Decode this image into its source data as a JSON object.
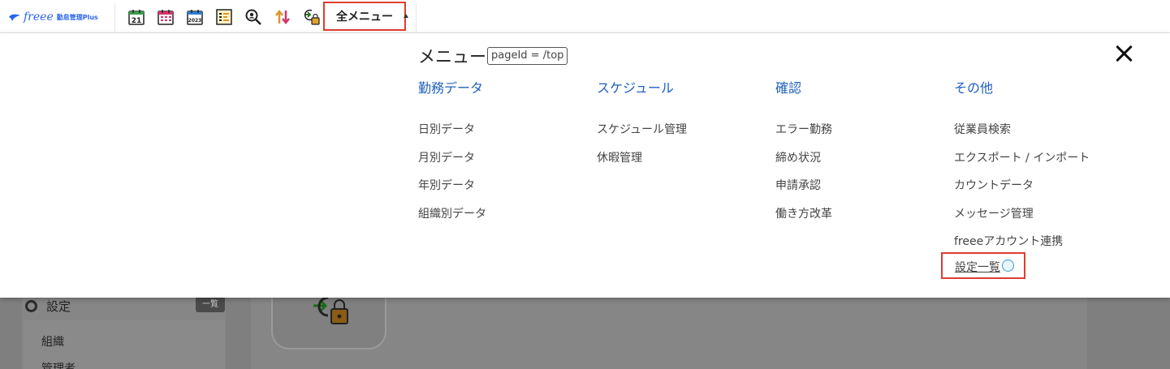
{
  "app": {
    "brand": "freee",
    "product": "勤怠管理Plus"
  },
  "toolbar": {
    "icons": [
      {
        "name": "daily-calendar-icon",
        "text": "21"
      },
      {
        "name": "monthly-calendar-icon"
      },
      {
        "name": "yearly-calendar-icon",
        "text": "2023"
      },
      {
        "name": "schedule-list-icon"
      },
      {
        "name": "search-employee-icon"
      },
      {
        "name": "import-export-icon"
      },
      {
        "name": "login-lock-icon"
      }
    ],
    "all_menu_label": "全メニュー"
  },
  "menu": {
    "title": "メニュー",
    "page_id": "pageId = /top",
    "columns": [
      {
        "heading": "勤務データ",
        "items": [
          "日別データ",
          "月別データ",
          "年別データ",
          "組織別データ"
        ]
      },
      {
        "heading": "スケジュール",
        "items": [
          "スケジュール管理",
          "休暇管理"
        ]
      },
      {
        "heading": "確認",
        "items": [
          "エラー勤務",
          "締め状況",
          "申請承認",
          "働き方改革"
        ]
      },
      {
        "heading": "その他",
        "items": [
          "従業員検索",
          "エクスポート / インポート",
          "カウントデータ",
          "メッセージ管理",
          "freeeアカウント連携"
        ]
      }
    ],
    "settings_list_label": "設定一覧"
  },
  "background": {
    "settings_label": "設定",
    "list_badge": "一覧",
    "sub_items": [
      "組織",
      "管理者"
    ]
  },
  "colors": {
    "accent_blue": "#1f5fbf",
    "highlight_red": "#e03c31",
    "overlay": "#7f7f7f"
  }
}
